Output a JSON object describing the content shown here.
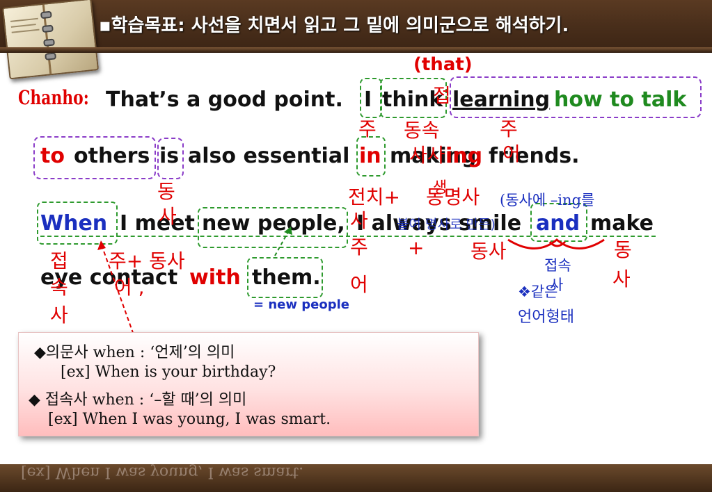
{
  "header": {
    "title": "▪학습목표: 사선을 치면서 읽고 그 밑에 의미군으로 해석하기."
  },
  "line1": {
    "speaker": "Chanho:",
    "text1": "That’s a good point.",
    "i": "I",
    "think": "think",
    "learning": "learning",
    "how_to_talk": "how to talk"
  },
  "line2": {
    "to": "to",
    "others": "others",
    "is": "is",
    "also": "also essential",
    "in": "in",
    "making": "making",
    "making_red": "ing",
    "friends": "friends."
  },
  "line3": {
    "when": "When",
    "i_meet": "I meet",
    "new_people": "new people,",
    "always": "I always smile",
    "and": "and",
    "make": "make"
  },
  "line4": {
    "eye_contact": "eye contact",
    "with": "with",
    "them": "them.",
    "them_note": "= new people"
  },
  "annotations": {
    "that": "(that)",
    "jeop_top": "접",
    "ju1": "주",
    "dongsok": "동속",
    "ju_right": "주",
    "eo_right": "어",
    "sa_mid": "사사",
    "saeng": "생",
    "dong_is": "동",
    "sa_is": "사",
    "jeonchi": "전치+",
    "dongmyeongsa": "동명사",
    "plus": "+",
    "ju_col": "주",
    "sa_col": "사",
    "eo_col": "어",
    "dongsa_ing": "(동사에 –ing를",
    "butyeo": "붙여 명사로 만든)",
    "jeop_when": "접",
    "sok_when": "속",
    "sa_when": "사",
    "jueo_plus": "주+ 동사",
    "eo_comma": "어 ,",
    "dongsa_mid": "동사",
    "dong_right": "동",
    "sa_right": "사",
    "jeopsok": "접속",
    "sa2": "사",
    "same_form1": "❖같은",
    "same_form2": "언어형태"
  },
  "note": {
    "line1": "◆의문사 when : ‘언제’의 의미",
    "line2": "[ex] When is your birthday?",
    "line3": "◆ 접속사 when : ‘–할 때’의 의미",
    "line4": "[ex] When I was young, I was smart."
  },
  "reflection": {
    "text": "[ex] When I was young, I was smart."
  }
}
